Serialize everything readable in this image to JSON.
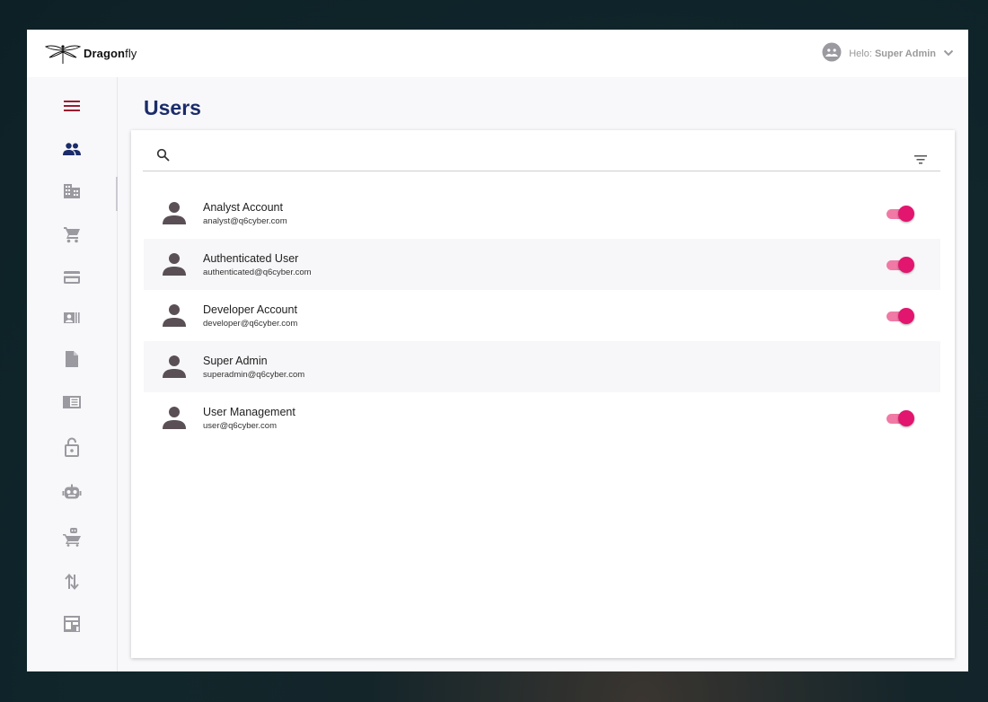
{
  "app": {
    "brand_prefix": "Dragon",
    "brand_suffix": "fly",
    "logo_icon": "dragonfly-logo-icon"
  },
  "header": {
    "greeting_prefix": "Helo: ",
    "user_name": "Super Admin",
    "user_icon": "account-circle-icon",
    "dropdown_icon": "chevron-down-icon"
  },
  "sidebar": {
    "items": [
      {
        "icon": "menu-icon",
        "color": "#9b1b30"
      },
      {
        "icon": "people-icon",
        "color": "#1b2c6a"
      },
      {
        "icon": "building-icon",
        "color": "#9a9aa0"
      },
      {
        "icon": "cart-icon",
        "color": "#9a9aa0"
      },
      {
        "icon": "credit-card-icon",
        "color": "#9a9aa0"
      },
      {
        "icon": "contact-card-icon",
        "color": "#9a9aa0"
      },
      {
        "icon": "document-icon",
        "color": "#9a9aa0"
      },
      {
        "icon": "reader-icon",
        "color": "#9a9aa0"
      },
      {
        "icon": "unlock-icon",
        "color": "#9a9aa0"
      },
      {
        "icon": "robot-icon",
        "color": "#9a9aa0"
      },
      {
        "icon": "cart-bot-icon",
        "color": "#9a9aa0"
      },
      {
        "icon": "transfer-arrows-icon",
        "color": "#9a9aa0"
      },
      {
        "icon": "store-icon",
        "color": "#9a9aa0"
      }
    ]
  },
  "page": {
    "title": "Users"
  },
  "search": {
    "placeholder": ""
  },
  "users": [
    {
      "name": "Analyst Account",
      "email": "analyst@q6cyber.com",
      "toggle_on": true
    },
    {
      "name": "Authenticated User",
      "email": "authenticated@q6cyber.com",
      "toggle_on": true
    },
    {
      "name": "Developer Account",
      "email": "developer@q6cyber.com",
      "toggle_on": true
    },
    {
      "name": "Super Admin",
      "email": "superadmin@q6cyber.com",
      "toggle_on": false
    },
    {
      "name": "User Management",
      "email": "user@q6cyber.com",
      "toggle_on": true
    }
  ],
  "colors": {
    "title": "#1b2c6a",
    "toggle_thumb": "#e2156f",
    "toggle_track": "#f07aa5",
    "avatar": "#5a4f55"
  }
}
